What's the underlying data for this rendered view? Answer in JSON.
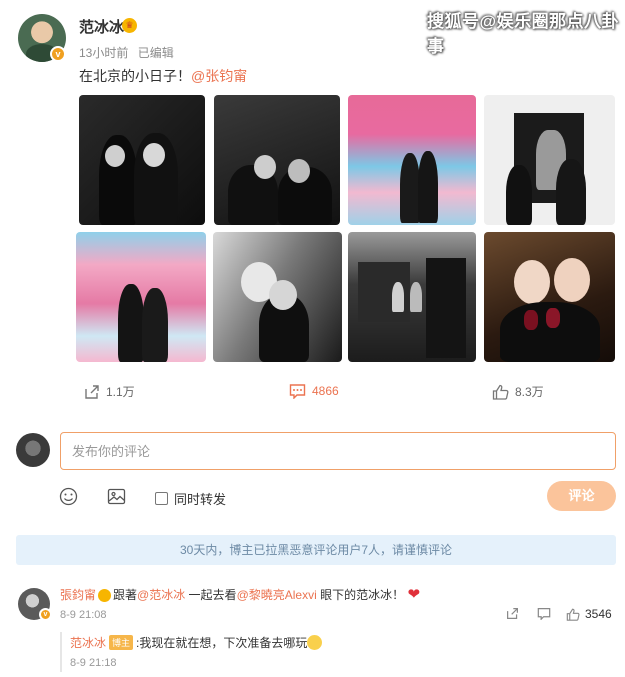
{
  "post": {
    "username": "范冰冰",
    "time": "13小时前",
    "edited": "已编辑",
    "text": "在北京的小日子！",
    "mention": "@张钧甯"
  },
  "watermark": "搜狐号@娱乐圈那点八卦事",
  "actions": {
    "repost_count": "1.1万",
    "comment_count": "4866",
    "like_count": "8.3万"
  },
  "comment_box": {
    "placeholder": "发布你的评论",
    "repost_label": "同时转发",
    "submit_label": "评论"
  },
  "notice": "30天内，博主已拉黑恶意评论用户7人，请谨慎评论",
  "comments": [
    {
      "user": "張鈞甯",
      "text_1": "跟著",
      "mention_1": "@范冰冰",
      "text_2": " 一起去看",
      "mention_2": "@黎曉亮Alexvi",
      "text_3": " 眼下的范冰冰！",
      "time": "8-9 21:08",
      "like_count": "3546",
      "reply": {
        "user": "范冰冰",
        "badge": "博主",
        "text": ":我现在就在想，下次准备去哪玩",
        "time": "8-9 21:18"
      }
    }
  ],
  "colors": {
    "accent": "#eb7350",
    "submit_bg": "#fbc49b",
    "notice_bg": "#e5f1fb",
    "notice_text": "#6d8aa5"
  }
}
